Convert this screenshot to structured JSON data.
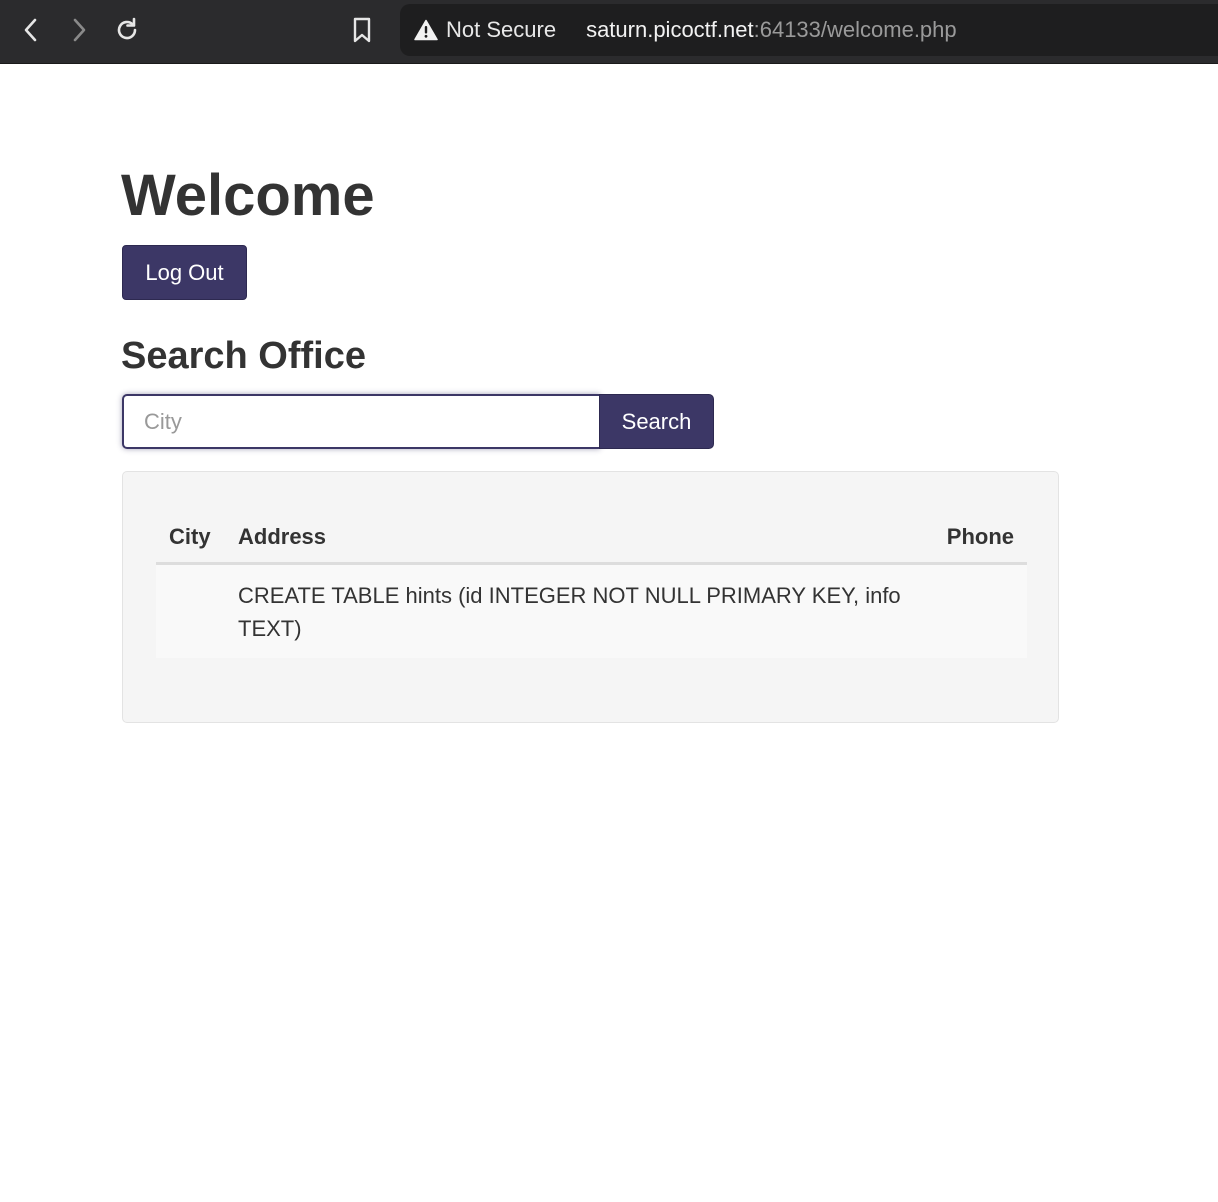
{
  "browser": {
    "back_icon": "chevron-left-icon",
    "forward_icon": "chevron-right-icon",
    "reload_icon": "reload-icon",
    "bookmark_icon": "bookmark-icon",
    "security_icon": "warning-triangle-icon",
    "security_label": "Not Secure",
    "url_host": "saturn.picoctf.net",
    "url_rest": ":64133/welcome.php"
  },
  "page": {
    "title": "Welcome",
    "logout_label": "Log Out",
    "search_heading": "Search Office",
    "search_placeholder": "City",
    "search_value": "",
    "search_button_label": "Search"
  },
  "table": {
    "headers": [
      "City",
      "Address",
      "Phone"
    ],
    "rows": [
      {
        "city": "",
        "address": "CREATE TABLE hints (id INTEGER NOT NULL PRIMARY KEY, info TEXT)",
        "phone": ""
      }
    ]
  },
  "colors": {
    "primary": "#3c3766",
    "toolbar": "#2b2b2d",
    "text": "#333333",
    "well": "#f5f5f5"
  }
}
